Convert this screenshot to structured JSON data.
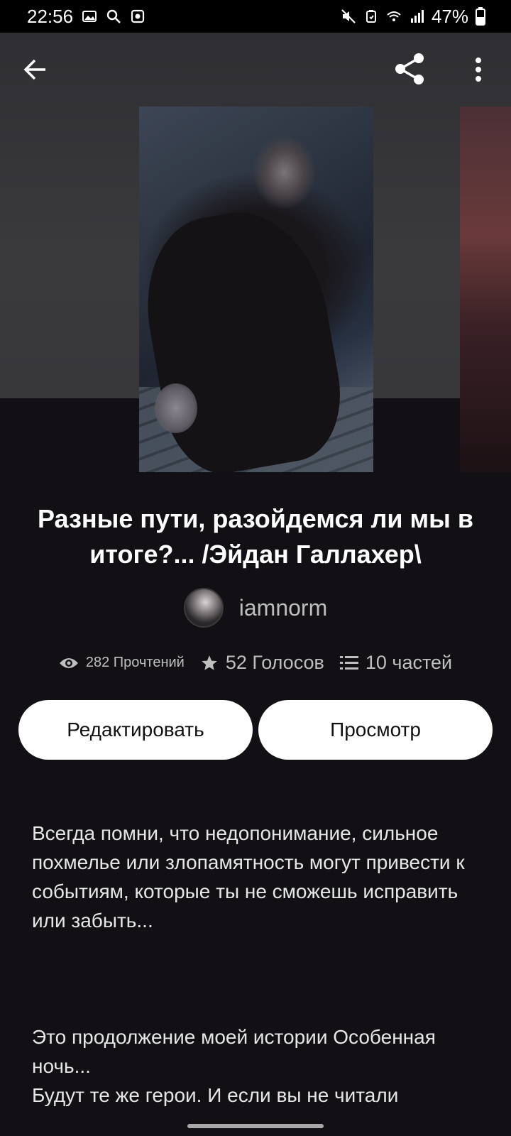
{
  "status_bar": {
    "time": "22:56",
    "battery": "47%"
  },
  "toolbar": {
    "back_icon": "arrow-left-icon",
    "share_icon": "share-icon",
    "more_icon": "more-vert-icon"
  },
  "story": {
    "title": "Разные пути, разойдемся ли мы в итоге?... /Эйдан Галлахер\\",
    "author": "iamnorm",
    "stats": {
      "reads": "282 Прочтений",
      "votes": "52 Голосов",
      "parts": "10 частей"
    }
  },
  "actions": {
    "edit_label": "Редактировать",
    "view_label": "Просмотр"
  },
  "description": {
    "paragraph1": "Всегда помни, что недопонимание, сильное похмелье или злопамятность могут привести к событиям, которые ты не сможешь исправить или забыть...",
    "paragraph2_line1": "Это продолжение моей истории Особенная ночь...",
    "paragraph2_line2": "Будут те же герои. И если вы не читали"
  },
  "colors": {
    "background": "#121014",
    "button_bg": "#ffffff",
    "button_text": "#121212",
    "muted_text": "#bfbfbf"
  }
}
